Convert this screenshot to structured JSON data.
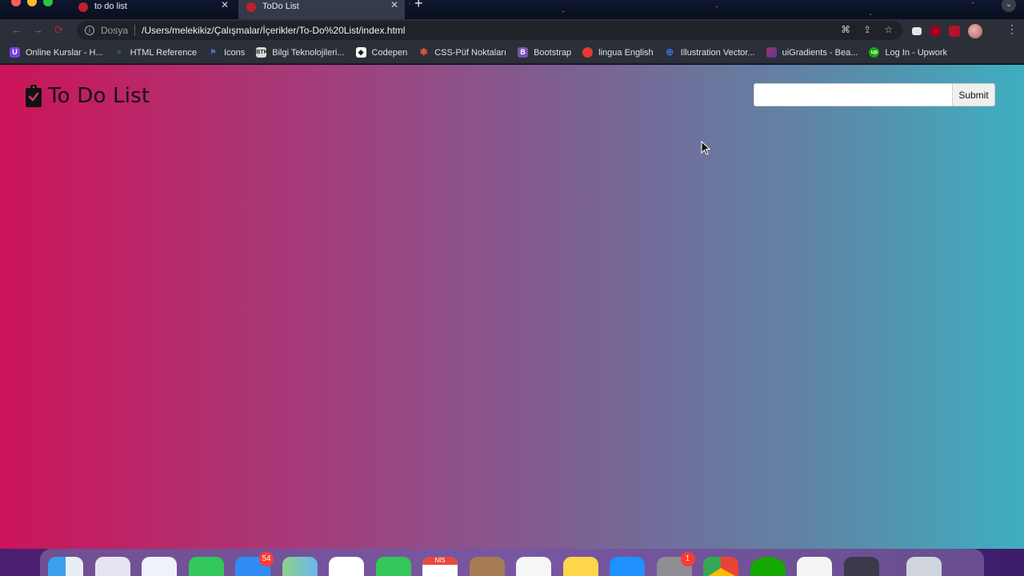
{
  "window": {
    "tabs": [
      {
        "label": "to do list",
        "active": false
      },
      {
        "label": "ToDo List",
        "active": true
      }
    ]
  },
  "toolbar": {
    "scheme_label": "Dosya",
    "url": "/Users/melekikiz/Çalışmalar/İçerikler/To-Do%20List/index.html"
  },
  "bookmarks": [
    {
      "label": "Online Kurslar - H...",
      "icon": "udemy-icon",
      "color": "#7b3fe4"
    },
    {
      "label": "HTML Reference",
      "icon": "wave-icon",
      "color": "#2e8b57"
    },
    {
      "label": "Icons",
      "icon": "flag-icon",
      "color": "#4a6fd8"
    },
    {
      "label": "Bilgi Teknolojileri...",
      "icon": "btk-icon",
      "color": "#d9d9d9"
    },
    {
      "label": "Codepen",
      "icon": "codepen-icon",
      "color": "#ffffff"
    },
    {
      "label": "CSS-Püf Noktaları",
      "icon": "asterisk-icon",
      "color": "#e0533a"
    },
    {
      "label": "Bootstrap",
      "icon": "bootstrap-icon",
      "color": "#7952b3"
    },
    {
      "label": "lingua English",
      "icon": "chat-icon",
      "color": "#e53935"
    },
    {
      "label": "Illustration Vector...",
      "icon": "globe-icon",
      "color": "#3b6fe0"
    },
    {
      "label": "uiGradients - Bea...",
      "icon": "gradient-icon",
      "color": "#a0306a"
    },
    {
      "label": "Log In - Upwork",
      "icon": "upwork-icon",
      "color": "#14a800"
    }
  ],
  "page": {
    "title": "To Do List",
    "input_value": "",
    "submit_label": "Submit",
    "gradient": [
      "#cc1459",
      "#3eaec0"
    ]
  },
  "dock": {
    "mail_badge": "54",
    "calendar_month": "NİS",
    "settings_badge": "1"
  }
}
